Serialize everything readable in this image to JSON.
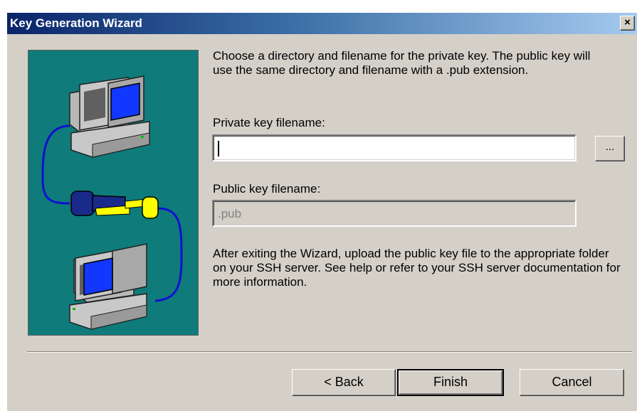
{
  "window": {
    "title": "Key Generation Wizard",
    "close_label": "×"
  },
  "content": {
    "intro": "Choose a directory and filename for the private key. The public key will use the same directory and filename with a .pub extension.",
    "private_label": "Private key filename:",
    "private_value": "",
    "browse_label": "...",
    "public_label": "Public key filename:",
    "public_value": ".pub",
    "outro": "After exiting the Wizard, upload the public key file to the appropriate folder on your SSH server.  See help or refer to your SSH server documentation for more information."
  },
  "buttons": {
    "back": "< Back",
    "finish": "Finish",
    "cancel": "Cancel"
  },
  "colors": {
    "titlebar": "#0a246a",
    "dialog_bg": "#d4d0c8",
    "graphic_bg": "#0f7b7a"
  },
  "icons": {
    "illustration": "two-computers-key-icon"
  }
}
